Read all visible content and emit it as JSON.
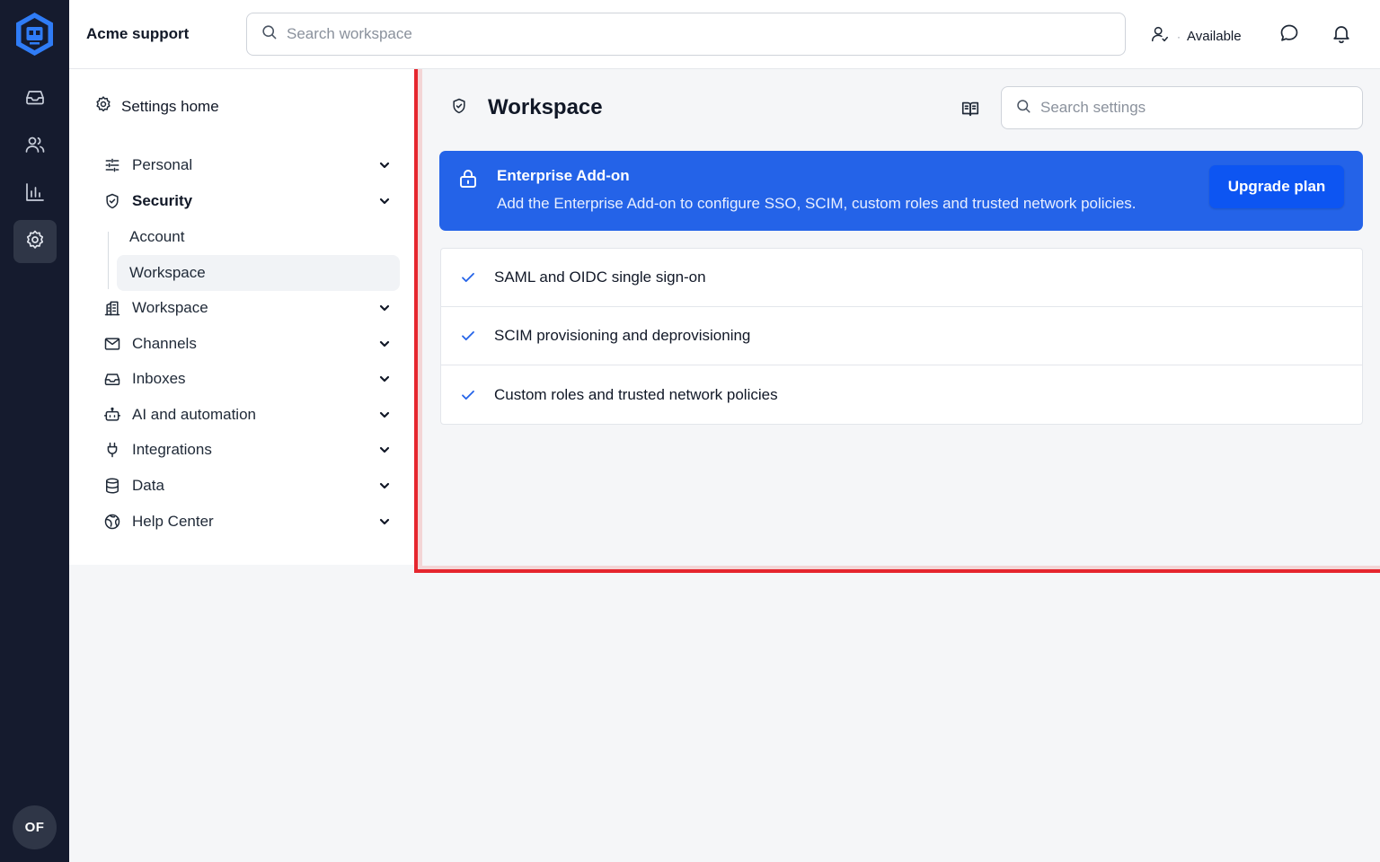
{
  "app": {
    "org_name": "Acme support",
    "user_initials": "OF"
  },
  "topbar": {
    "search_placeholder": "Search workspace",
    "status_separator": "·",
    "status_label": "Available"
  },
  "rail": {
    "items": [
      {
        "icon": "inbox-icon"
      },
      {
        "icon": "contacts-icon"
      },
      {
        "icon": "reports-icon"
      },
      {
        "icon": "settings-icon",
        "active": true
      }
    ]
  },
  "settings_nav": {
    "home_label": "Settings home",
    "sections": [
      {
        "label": "Personal",
        "icon": "sliders-icon"
      },
      {
        "label": "Security",
        "icon": "shield-icon",
        "expanded": true
      },
      {
        "label": "Workspace",
        "icon": "building-icon"
      },
      {
        "label": "Channels",
        "icon": "mail-icon"
      },
      {
        "label": "Inboxes",
        "icon": "inbox-icon"
      },
      {
        "label": "AI and automation",
        "icon": "bot-icon"
      },
      {
        "label": "Integrations",
        "icon": "plug-icon"
      },
      {
        "label": "Data",
        "icon": "database-icon"
      },
      {
        "label": "Help Center",
        "icon": "globe-icon"
      }
    ],
    "security_children": [
      {
        "label": "Account"
      },
      {
        "label": "Workspace",
        "active": true
      }
    ]
  },
  "main": {
    "title": "Workspace",
    "search_placeholder": "Search settings",
    "banner": {
      "title": "Enterprise Add-on",
      "text": "Add the Enterprise Add-on to configure SSO, SCIM, custom roles and trusted network policies.",
      "button_label": "Upgrade plan",
      "bg_color": "#2463e8"
    },
    "features": [
      "SAML and OIDC single sign-on",
      "SCIM provisioning and deprovisioning",
      "Custom roles and trusted network policies"
    ]
  },
  "colors": {
    "rail": "#151b2e",
    "accent": "#2463e8",
    "highlight_border": "#e5262e"
  }
}
